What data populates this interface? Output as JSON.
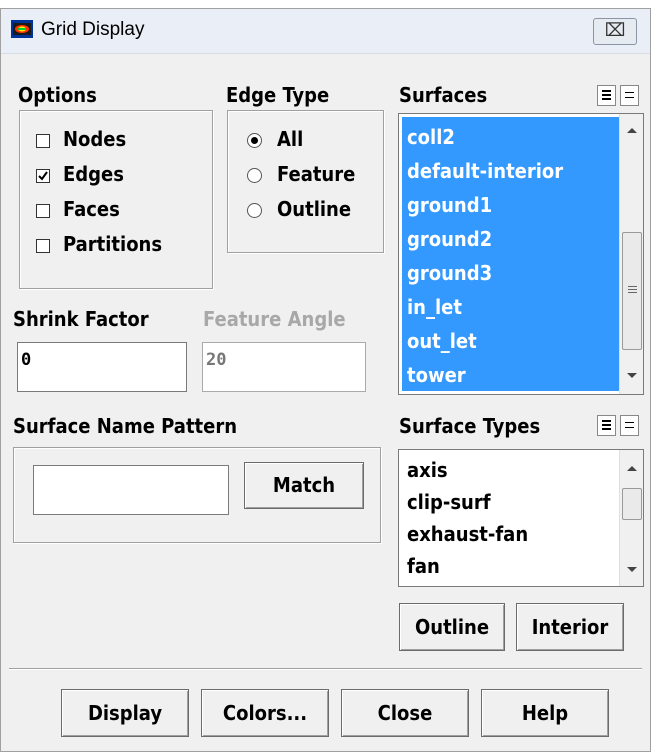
{
  "window": {
    "title": "Grid Display",
    "close_glyph": "⌧"
  },
  "options": {
    "heading": "Options",
    "items": [
      {
        "label": "Nodes",
        "checked": false
      },
      {
        "label": "Edges",
        "checked": true
      },
      {
        "label": "Faces",
        "checked": false
      },
      {
        "label": "Partitions",
        "checked": false
      }
    ]
  },
  "edge_type": {
    "heading": "Edge Type",
    "items": [
      {
        "label": "All",
        "selected": true
      },
      {
        "label": "Feature",
        "selected": false
      },
      {
        "label": "Outline",
        "selected": false
      }
    ]
  },
  "surfaces": {
    "heading": "Surfaces",
    "items": [
      "coll2",
      "default-interior",
      "ground1",
      "ground2",
      "ground3",
      "in_let",
      "out_let",
      "tower"
    ],
    "all_selected": true,
    "selection_color": "#3399ff"
  },
  "shrink_factor": {
    "label": "Shrink Factor",
    "value": "0"
  },
  "feature_angle": {
    "label": "Feature Angle",
    "value": "20",
    "enabled": false
  },
  "surface_name_pattern": {
    "label": "Surface Name Pattern",
    "value": "",
    "match_label": "Match"
  },
  "surface_types": {
    "heading": "Surface Types",
    "items": [
      "axis",
      "clip-surf",
      "exhaust-fan",
      "fan"
    ]
  },
  "type_buttons": {
    "outline": "Outline",
    "interior": "Interior"
  },
  "footer": {
    "display": "Display",
    "colors": "Colors...",
    "close": "Close",
    "help": "Help"
  },
  "icons": {
    "app": "fluent-app-icon",
    "close": "close-icon",
    "scroll_up": "scroll-up-arrow-icon",
    "scroll_down": "scroll-down-arrow-icon",
    "select_all": "select-all-icon",
    "deselect_all": "deselect-all-icon"
  }
}
